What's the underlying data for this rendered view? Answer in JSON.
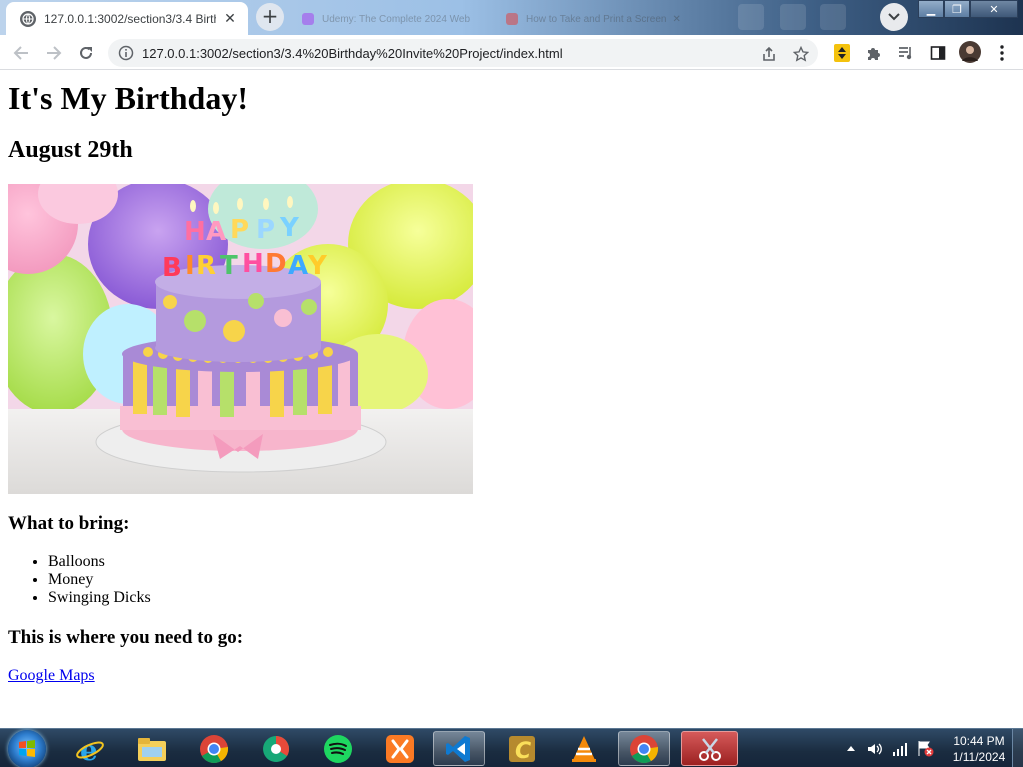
{
  "browser": {
    "tabs": [
      {
        "title": "127.0.0.1:3002/section3/3.4 Birth",
        "active": true
      },
      {
        "title": "Udemy: The Complete 2024 Web",
        "active": false
      },
      {
        "title": "How to Take and Print a Screen",
        "active": false
      }
    ],
    "address": "127.0.0.1:3002/section3/3.4%20Birthday%20Invite%20Project/index.html",
    "icons": [
      "back-icon",
      "forward-icon",
      "reload-icon",
      "info-icon",
      "share-icon",
      "star-icon",
      "extension-icon",
      "puzzle-icon",
      "media-icon",
      "sidepanel-icon",
      "profile-avatar",
      "menu-icon"
    ]
  },
  "page": {
    "title": "It's My Birthday!",
    "date": "August 29th",
    "image_alt": "birthday cake",
    "bring_heading": "What to bring:",
    "bring_items": [
      "Balloons",
      "Money",
      "Swinging Dicks"
    ],
    "where_heading": "This is where you need to go:",
    "map_link": "Google Maps"
  },
  "taskbar": {
    "apps": [
      "internet-explorer",
      "file-explorer",
      "chrome",
      "git-kraken",
      "spotify",
      "xampp",
      "vscode",
      "codeblocks",
      "vlc",
      "chrome",
      "snipping-tool"
    ],
    "time": "10:44 PM",
    "date": "1/11/2024"
  },
  "colors": {
    "link": "#0000ee",
    "tab_bg": "#ffffff",
    "taskbar": "#1a2c40"
  }
}
